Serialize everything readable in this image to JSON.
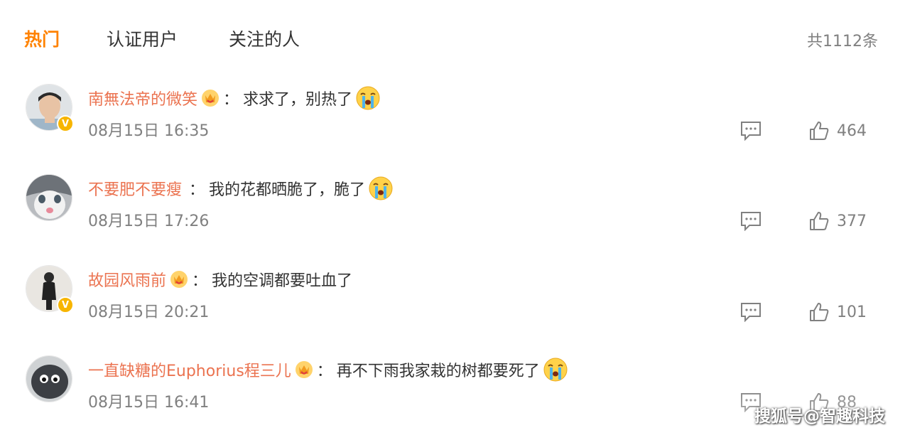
{
  "tabs": [
    {
      "label": "热门",
      "active": true
    },
    {
      "label": "认证用户",
      "active": false
    },
    {
      "label": "关注的人",
      "active": false
    }
  ],
  "total_count": "共1112条",
  "colors": {
    "accent": "#ff8200",
    "username": "#eb7350",
    "meta": "#808080",
    "verified": "#f7b500"
  },
  "comments": [
    {
      "username": "南無法帝的微笑",
      "text": "求求了，别热了",
      "time": "08月15日 16:35",
      "likes": "464",
      "verified": true,
      "crown_badge": true,
      "emoji": "crying-face"
    },
    {
      "username": "不要肥不要瘦",
      "text": "我的花都晒脆了，脆了",
      "time": "08月15日 17:26",
      "likes": "377",
      "verified": false,
      "crown_badge": false,
      "emoji": "crying-face"
    },
    {
      "username": "故园风雨前",
      "text": "我的空调都要吐血了",
      "time": "08月15日 20:21",
      "likes": "101",
      "verified": true,
      "crown_badge": true,
      "emoji": ""
    },
    {
      "username": "一直缺糖的Euphorius程三儿",
      "text": "再不下雨我家栽的树都要死了",
      "time": "08月15日 16:41",
      "likes": "88",
      "verified": false,
      "crown_badge": true,
      "emoji": "crying-face"
    }
  ],
  "colon": "：",
  "icons": {
    "reply": "comment-icon",
    "like": "thumbs-up-icon",
    "verified": "verified-v-badge-icon",
    "crown": "vip-crown-badge-icon"
  },
  "watermark": "搜狐号@智趣科技"
}
